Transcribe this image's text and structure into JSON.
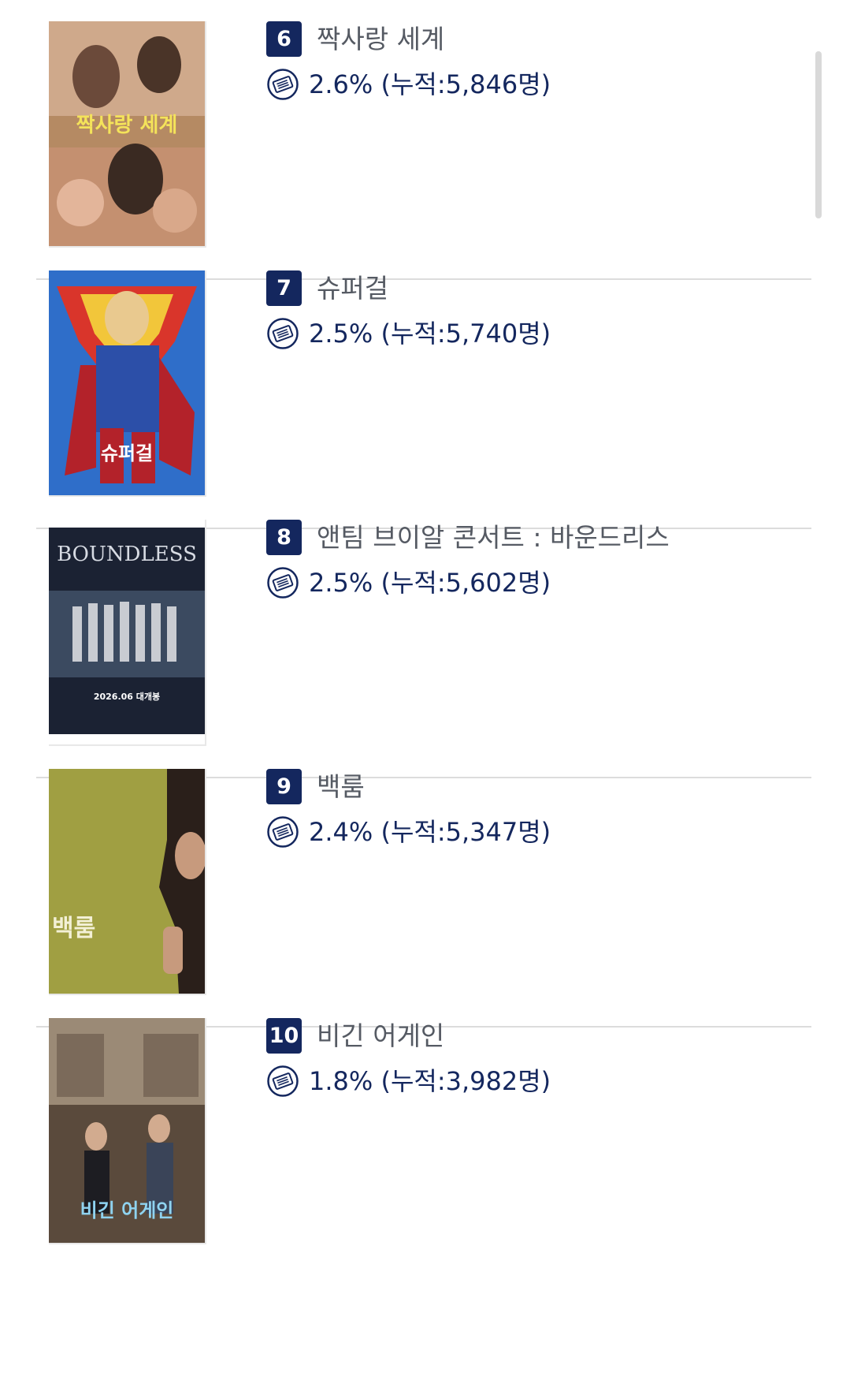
{
  "ranking": {
    "items": [
      {
        "rank": "6",
        "title": "짝사랑 세계",
        "stat": "2.6% (누적:5,846명)",
        "poster": {
          "text": "짝사랑 세계",
          "bg": "#b58a63"
        }
      },
      {
        "rank": "7",
        "title": "슈퍼걸",
        "stat": "2.5% (누적:5,740명)",
        "poster": {
          "text": "슈퍼걸",
          "bg": "#2f6ec9"
        }
      },
      {
        "rank": "8",
        "title": "앤팀 브이알 콘서트 : 바운드리스",
        "stat": "2.5% (누적:5,602명)",
        "poster": {
          "text": "BOUNDLESS",
          "subtext": "2026.06 대개봉",
          "bg": "#1b2233"
        }
      },
      {
        "rank": "9",
        "title": "백룸",
        "stat": "2.4% (누적:5,347명)",
        "poster": {
          "text": "백룸",
          "bg": "#9a9a3e"
        }
      },
      {
        "rank": "10",
        "title": "비긴 어게인",
        "stat": "1.8% (누적:3,982명)",
        "poster": {
          "text": "비긴 어게인",
          "bg": "#6b5847"
        }
      }
    ],
    "icons": {
      "rank": "rank-badge",
      "stat": "ticket-icon"
    },
    "colors": {
      "accent": "#14275e",
      "title_text": "#555a63",
      "divider": "#dcdcdc"
    }
  }
}
